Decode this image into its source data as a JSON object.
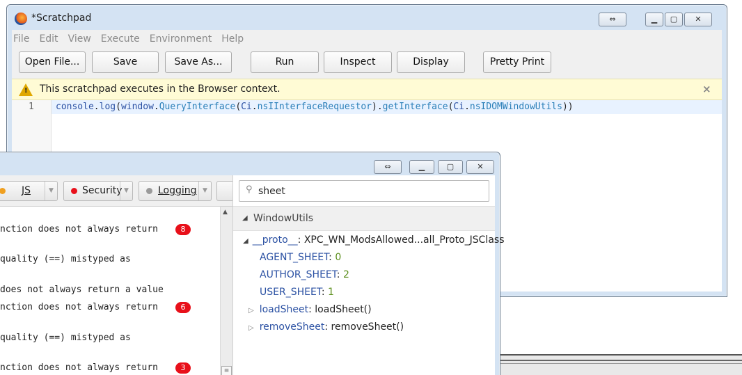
{
  "scratchpad": {
    "title": "*Scratchpad",
    "menu": [
      "File",
      "Edit",
      "View",
      "Execute",
      "Environment",
      "Help"
    ],
    "toolbar": {
      "open_file": "Open File...",
      "save": "Save",
      "save_as": "Save As...",
      "run": "Run",
      "inspect": "Inspect",
      "display": "Display",
      "pretty_print": "Pretty Print"
    },
    "notification": "This scratchpad executes in the Browser context.",
    "editor": {
      "line_number": "1",
      "code": [
        {
          "t": "console",
          "c": "#2b51a3"
        },
        {
          "t": ".",
          "c": "#222"
        },
        {
          "t": "log",
          "c": "#2b51a3"
        },
        {
          "t": "(",
          "c": "#222"
        },
        {
          "t": "window",
          "c": "#2b51a3"
        },
        {
          "t": ".",
          "c": "#222"
        },
        {
          "t": "QueryInterface",
          "c": "#2a7fb8"
        },
        {
          "t": "(",
          "c": "#222"
        },
        {
          "t": "Ci",
          "c": "#2b51a3"
        },
        {
          "t": ".",
          "c": "#222"
        },
        {
          "t": "nsIInterfaceRequestor",
          "c": "#2a7fb8"
        },
        {
          "t": ").",
          "c": "#222"
        },
        {
          "t": "getInterface",
          "c": "#2a7fb8"
        },
        {
          "t": "(",
          "c": "#222"
        },
        {
          "t": "Ci",
          "c": "#2b51a3"
        },
        {
          "t": ".",
          "c": "#222"
        },
        {
          "t": "nsIDOMWindowUtils",
          "c": "#2a7fb8"
        },
        {
          "t": "))",
          "c": "#222"
        }
      ]
    }
  },
  "console_window": {
    "filters": {
      "js": "JS",
      "security": "Security",
      "logging": "Logging"
    },
    "messages": [
      {
        "text": "nction does not always return",
        "badge": "8"
      },
      {
        "text": "quality (==) mistyped as",
        "badge": ""
      },
      {
        "text": "does not always return a value",
        "badge": ""
      },
      {
        "text": "nction does not always return",
        "badge": "6"
      },
      {
        "text": "quality (==) mistyped as",
        "badge": ""
      },
      {
        "text": "nction does not always return",
        "badge": "3"
      }
    ],
    "search_value": "sheet",
    "variables": {
      "scope": "WindowUtils",
      "proto_key": "__proto__",
      "proto_value": "XPC_WN_ModsAllowed...all_Proto_JSClass",
      "props": [
        {
          "key": "AGENT_SHEET",
          "value": "0"
        },
        {
          "key": "AUTHOR_SHEET",
          "value": "2"
        },
        {
          "key": "USER_SHEET",
          "value": "1"
        }
      ],
      "methods": [
        {
          "key": "loadSheet",
          "value": "loadSheet()"
        },
        {
          "key": "removeSheet",
          "value": "removeSheet()"
        }
      ]
    }
  },
  "colors": {
    "window_chrome": "#d4e3f3",
    "notification_bg": "#fffbd5",
    "active_line": "#e8f2ff",
    "badge": "#e8101a",
    "security_dot": "#e8101a",
    "js_dot": "#f0a020",
    "logging_dot": "#9a9a9a"
  }
}
